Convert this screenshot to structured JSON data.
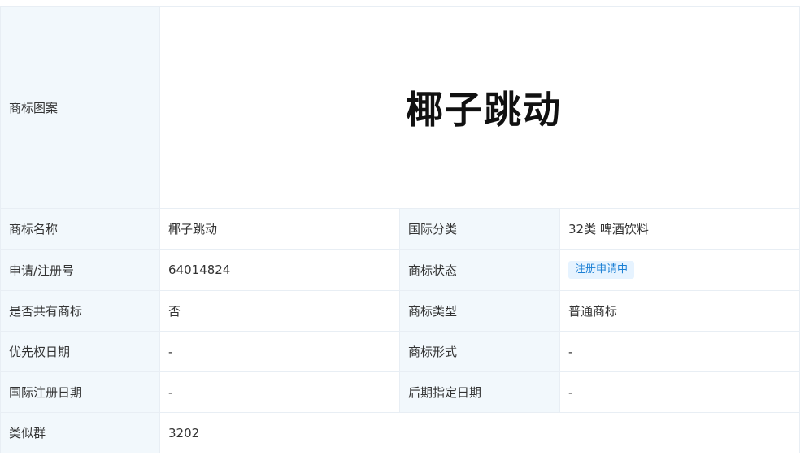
{
  "trademark": {
    "logo": {
      "label": "商标图案",
      "image_text": "椰子跳动"
    },
    "rows": [
      {
        "left_label": "商标名称",
        "left_value": "椰子跳动",
        "right_label": "国际分类",
        "right_value": "32类 啤酒饮料"
      },
      {
        "left_label": "申请/注册号",
        "left_value": "64014824",
        "right_label": "商标状态",
        "right_value": "注册申请中"
      },
      {
        "left_label": "是否共有商标",
        "left_value": "否",
        "right_label": "商标类型",
        "right_value": "普通商标"
      },
      {
        "left_label": "优先权日期",
        "left_value": "-",
        "right_label": "商标形式",
        "right_value": "-"
      },
      {
        "left_label": "国际注册日期",
        "left_value": "-",
        "right_label": "后期指定日期",
        "right_value": "-"
      }
    ],
    "similar_group": {
      "label": "类似群",
      "value": "3202"
    }
  },
  "colors": {
    "label_bg": "#f2f8fc",
    "border": "#e8eef4",
    "badge_bg": "#e6f3ff",
    "badge_text": "#1a7fd4"
  }
}
